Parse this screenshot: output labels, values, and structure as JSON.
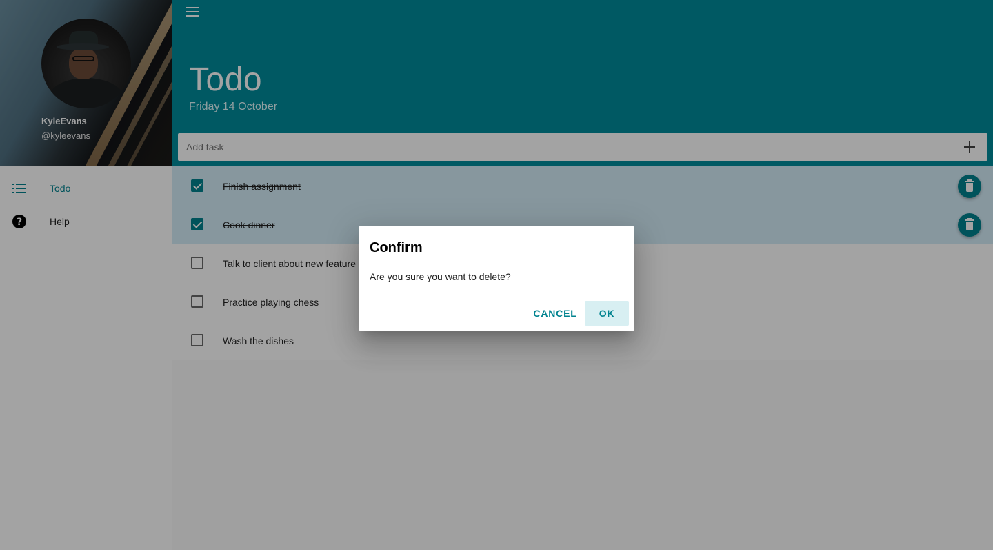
{
  "sidebar": {
    "user": {
      "name": "KyleEvans",
      "handle": "@kyleevans"
    },
    "items": [
      {
        "label": "Todo",
        "icon": "list-icon",
        "active": true
      },
      {
        "label": "Help",
        "icon": "help-icon",
        "active": false
      }
    ]
  },
  "header": {
    "title": "Todo",
    "date": "Friday 14 October",
    "add_task_placeholder": "Add task"
  },
  "tasks": [
    {
      "text": "Finish assignment",
      "done": true
    },
    {
      "text": "Cook dinner",
      "done": true
    },
    {
      "text": "Talk to client about new feature",
      "done": false
    },
    {
      "text": "Practice playing chess",
      "done": false
    },
    {
      "text": "Wash the dishes",
      "done": false
    }
  ],
  "dialog": {
    "title": "Confirm",
    "message": "Are you sure you want to delete?",
    "cancel_label": "CANCEL",
    "ok_label": "OK"
  },
  "colors": {
    "primary": "#008b9b",
    "accent": "#00838f",
    "done_row": "#d4ecf7"
  }
}
